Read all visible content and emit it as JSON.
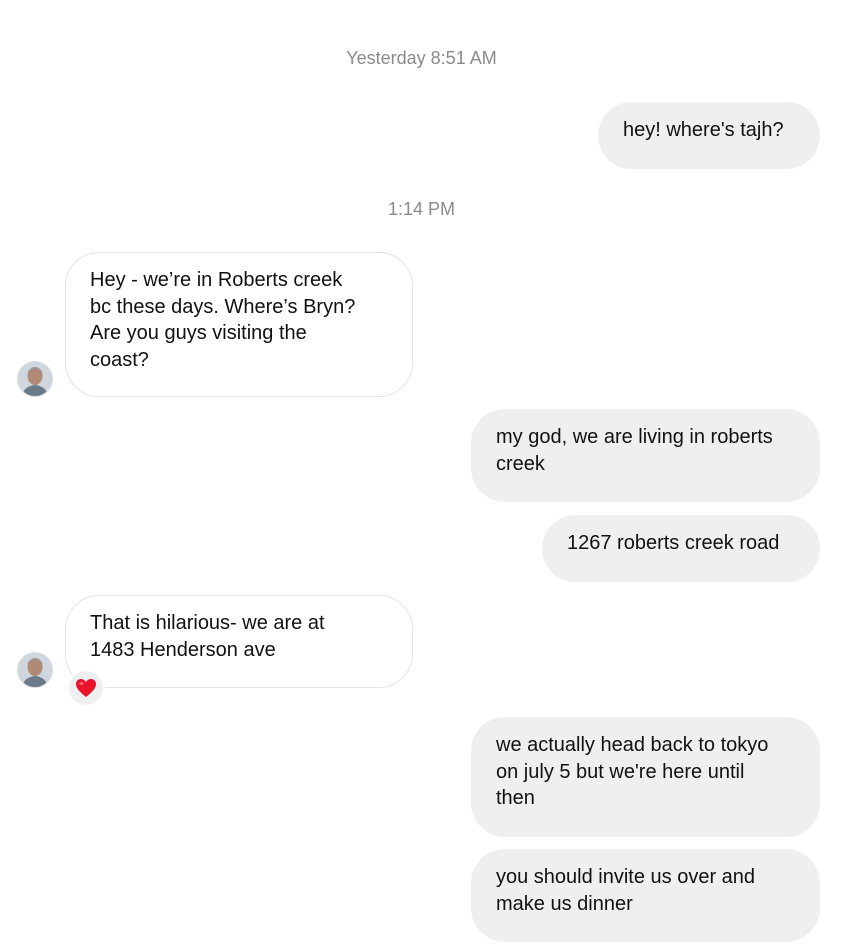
{
  "thread": {
    "timestamps": [
      "Yesterday 8:51 AM",
      "1:14 PM"
    ],
    "messages": [
      {
        "from": "me",
        "text": "hey! where's tajh?"
      },
      {
        "from": "them",
        "text": "Hey - we’re in Roberts creek\nbc these days. Where’s Bryn?\nAre you guys visiting the\ncoast?"
      },
      {
        "from": "me",
        "text": "my god, we are living in roberts\ncreek"
      },
      {
        "from": "me",
        "text": "1267 roberts creek road"
      },
      {
        "from": "them",
        "text": "That is hilarious- we are at\n1483 Henderson ave",
        "reaction": "heart-icon"
      },
      {
        "from": "me",
        "text": "we actually head back to tokyo\non july 5 but we're here until\nthen"
      },
      {
        "from": "me",
        "text": "you should invite us over and\nmake us dinner"
      }
    ]
  },
  "colors": {
    "outgoing_bubble": "#efefef",
    "incoming_border": "#e3e3e3",
    "timestamp": "#8a8a8a",
    "heart": "#e8132b"
  }
}
